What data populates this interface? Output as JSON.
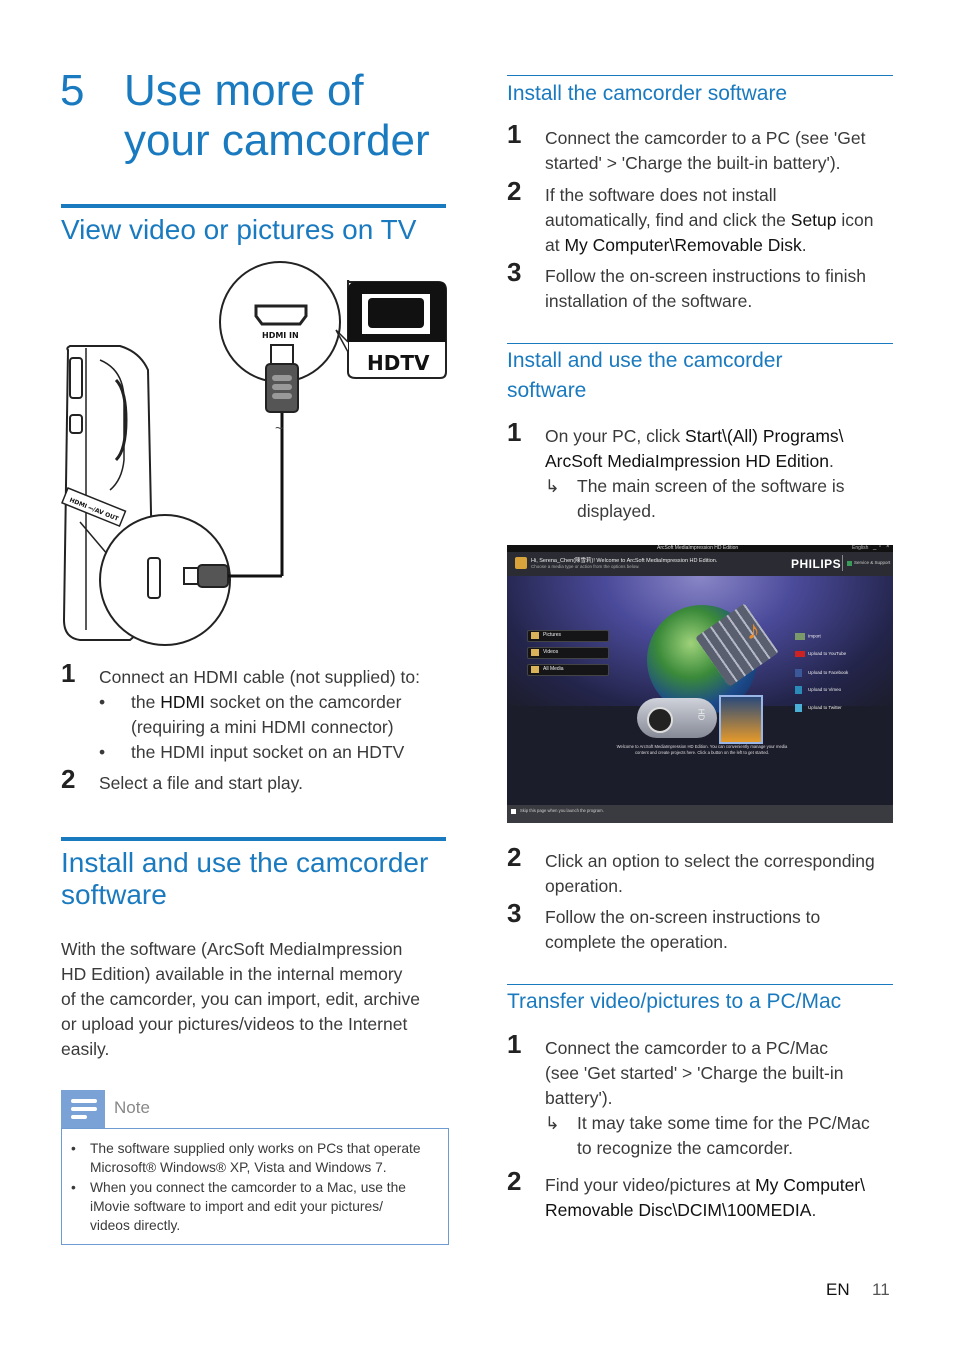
{
  "chapter": {
    "number": "5",
    "title_line1": "Use more of",
    "title_line2": "your camcorder"
  },
  "left": {
    "tv_section": {
      "heading": "View video or pictures on TV",
      "diagram": {
        "hdmi_in_label": "HDMI IN",
        "hdtv_label": "HDTV",
        "camcorder_port_label": "HDMI  ⎓/AV OUT"
      },
      "steps": [
        {
          "num": "1",
          "text": "Connect an HDMI cable (not supplied) to:",
          "bullets": [
            {
              "pre": "the ",
              "bold": "HDMI",
              "post": " socket on the camcorder",
              "line2": "(requiring a mini HDMI connector)"
            },
            {
              "pre": "the HDMI input socket on an HDTV",
              "bold": "",
              "post": "",
              "line2": ""
            }
          ]
        },
        {
          "num": "2",
          "text": "Select a file and start play."
        }
      ]
    },
    "software_section": {
      "heading_line1": "Install and use the camcorder",
      "heading_line2": "software",
      "paragraph": [
        "With the software (ArcSoft MediaImpression",
        "HD Edition) available in the internal memory",
        "of the camcorder, you can import, edit, archive",
        "or upload your pictures/videos to the Internet",
        "easily."
      ]
    },
    "note": {
      "label": "Note",
      "items": [
        {
          "line1": "The software supplied only works on PCs that operate",
          "line2": "Microsoft® Windows® XP, Vista and Windows 7."
        },
        {
          "line1": "When you connect the camcorder to a Mac, use the",
          "line2": "iMovie software to import and edit your pictures/",
          "line3": "videos directly."
        }
      ]
    }
  },
  "right": {
    "install": {
      "heading": "Install the camcorder software",
      "steps": [
        {
          "num": "1",
          "l1": "Connect the camcorder to a PC (see 'Get",
          "l2": "started' > 'Charge the built-in battery')."
        },
        {
          "num": "2",
          "l1": "If the software does not install",
          "l2a": "automatically, find and click the ",
          "l2b": "Setup",
          "l2c": " icon",
          "l3a": "at ",
          "l3b": "My Computer\\Removable Disk",
          "l3c": "."
        },
        {
          "num": "3",
          "l1": "Follow the on-screen instructions to finish",
          "l2": "installation of the software."
        }
      ]
    },
    "use": {
      "heading_line1": "Install and use the camcorder",
      "heading_line2": "software",
      "step1": {
        "num": "1",
        "l1a": "On your PC, click ",
        "l1b": "Start\\(All) Programs\\",
        "l2b": "ArcSoft MediaImpression HD Edition",
        "l2c": ".",
        "result_l1": "The main screen of the software is",
        "result_l2": "displayed."
      },
      "screenshot": {
        "window_title": "ArcSoft MediaImpression HD Edition",
        "language": "English",
        "greeting": "Hi, Serena_Chen(陳雪莉)! Welcome to ArcSoft MediaImpression HD Edition.",
        "subgreeting": "Choose a media type or action from the options below.",
        "brand": "PHILIPS",
        "support": "Service & Support",
        "left_buttons": [
          "Pictures",
          "Videos",
          "All Media"
        ],
        "right_actions": [
          "Import",
          "Upload to YouTube",
          "Upload to Facebook",
          "Upload to Vimeo",
          "Upload to Twitter"
        ],
        "welcome_l1": "Welcome to ArcSoft MediaImpression HD Edition. You can conveniently manage your media",
        "welcome_l2": "content and create projects here. Click a button on the left to get started.",
        "skip_checkbox": "Skip this page when you launch the program.",
        "camera_badge": "HD"
      },
      "steps": [
        {
          "num": "2",
          "l1": "Click an option to select the corresponding",
          "l2": "operation."
        },
        {
          "num": "3",
          "l1": "Follow the on-screen instructions to",
          "l2": "complete the operation."
        }
      ]
    },
    "transfer": {
      "heading": "Transfer video/pictures to a PC/Mac",
      "step1": {
        "num": "1",
        "l1": "Connect the camcorder to a PC/Mac",
        "l2": "(see 'Get started' > 'Charge the built-in",
        "l3": "battery').",
        "result_l1": "It may take some time for the PC/Mac",
        "result_l2": "to recognize the camcorder."
      },
      "step2": {
        "num": "2",
        "l1a": "Find your video/pictures at ",
        "l1b": "My Computer\\",
        "l2b": "Removable Disc\\DCIM\\100MEDIA",
        "l2c": "."
      }
    }
  },
  "footer": {
    "lang": "EN",
    "page": "11"
  },
  "icons": {
    "bullet": "•",
    "arrow": "↳",
    "close": "×",
    "minimize": "_",
    "restore": "▫"
  }
}
